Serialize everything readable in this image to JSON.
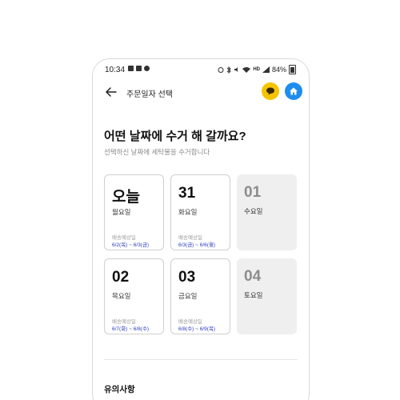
{
  "status_bar": {
    "time": "10:34",
    "left_icons": [
      "gallery-icon",
      "message-icon",
      "chat-icon"
    ],
    "network": "HD",
    "battery": "84%"
  },
  "header": {
    "title": "주문일자 선택",
    "back_icon": "back-arrow-icon",
    "chat_color": "#f5c400",
    "home_color": "#1f8ded"
  },
  "question": {
    "title": "어떤 날짜에 수거 해 갈까요?",
    "subtitle": "선택하신 날짜에 세탁물을 수거합니다"
  },
  "dates": [
    {
      "num": "오늘",
      "day": "월요일",
      "delivery_label": "배송예상일",
      "range": "6/2(목) ~ 6/3(금)",
      "enabled": true
    },
    {
      "num": "31",
      "day": "화요일",
      "delivery_label": "배송예상일",
      "range": "6/3(금) ~ 6/6(월)",
      "enabled": true
    },
    {
      "num": "01",
      "day": "수요일",
      "delivery_label": "",
      "range": "",
      "enabled": false
    },
    {
      "num": "02",
      "day": "목요일",
      "delivery_label": "배송예상일",
      "range": "6/7(화) ~ 6/8(수)",
      "enabled": true
    },
    {
      "num": "03",
      "day": "금요일",
      "delivery_label": "배송예상일",
      "range": "6/8(수) ~ 6/9(목)",
      "enabled": true
    },
    {
      "num": "04",
      "day": "토요일",
      "delivery_label": "",
      "range": "",
      "enabled": false
    }
  ],
  "notice": {
    "title": "유의사항"
  },
  "colors": {
    "range_text": "#2a3bbf",
    "disabled_bg": "#efefef"
  }
}
